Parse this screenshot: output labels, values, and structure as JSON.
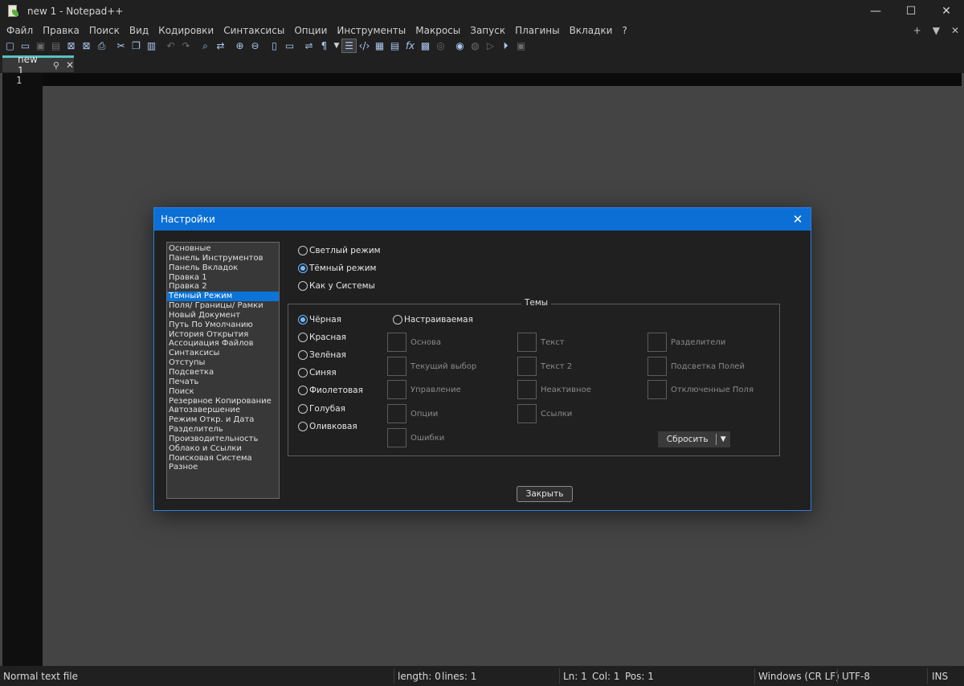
{
  "window": {
    "title": "new 1 - Notepad++",
    "controls": [
      "—",
      "☐",
      "✕"
    ]
  },
  "menu": {
    "items": [
      "Файл",
      "Правка",
      "Поиск",
      "Вид",
      "Кодировки",
      "Синтаксисы",
      "Опции",
      "Инструменты",
      "Макросы",
      "Запуск",
      "Плагины",
      "Вкладки",
      "?"
    ],
    "right": [
      "+",
      "▼",
      "✕"
    ]
  },
  "toolbar": {
    "icons": [
      "new-file-icon",
      "open-file-icon",
      "save-icon",
      "save-all-icon",
      "close-icon",
      "close-all-icon",
      "print-icon",
      "cut-icon",
      "copy-icon",
      "paste-icon",
      "undo-icon",
      "redo-icon",
      "find-icon",
      "replace-icon",
      "zoom-in-icon",
      "zoom-out-icon",
      "sync-vertical-icon",
      "sync-horizontal-icon",
      "word-wrap-icon",
      "show-all-chars-icon",
      "dropdown-icon",
      "indent-guide-icon",
      "lang-xml-icon",
      "doc-map-icon",
      "doc-list-icon",
      "function-list-icon",
      "folder-workspace-icon",
      "monitoring-icon",
      "record-macro-icon",
      "stop-macro-icon",
      "play-macro-icon",
      "play-multiple-icon",
      "save-macro-icon"
    ]
  },
  "tab": {
    "label": "new 1",
    "pin": "📌",
    "close": "✕"
  },
  "editor": {
    "line_number": "1"
  },
  "status": {
    "file_type": "Normal text file",
    "length": "length: 0",
    "lines": "lines: 1",
    "ln": "Ln: 1",
    "col": "Col: 1",
    "pos": "Pos: 1",
    "eol": "Windows (CR LF)",
    "encoding": "UTF-8",
    "mode": "INS"
  },
  "dialog": {
    "title": "Настройки",
    "close": "✕",
    "categories": [
      "Основные",
      "Панель Инструментов",
      "Панель Вкладок",
      "Правка 1",
      "Правка 2",
      "Тёмный Режим",
      "Поля/ Границы/ Рамки",
      "Новый Документ",
      "Путь По Умолчанию",
      "История Открытия",
      "Ассоциация Файлов",
      "Синтаксисы",
      "Отступы",
      "Подсветка",
      "Печать",
      "Поиск",
      "Резервное Копирование",
      "Автозавершение",
      "Режим Откр. и Дата",
      "Разделитель",
      "Производительность",
      "Облако и Ссылки",
      "Поисковая Система",
      "Разное"
    ],
    "selected_category": "Тёмный Режим",
    "modes": {
      "light": "Светлый режим",
      "dark": "Тёмный режим",
      "system": "Как у Системы",
      "selected": "dark"
    },
    "themes_label": "Темы",
    "themes": {
      "black": "Чёрная",
      "red": "Красная",
      "green": "Зелёная",
      "blue": "Синяя",
      "purple": "Фиолетовая",
      "cyan": "Голубая",
      "olive": "Оливковая",
      "custom": "Настраиваемая",
      "selected": "black"
    },
    "colors": {
      "base": "Основа",
      "current_selection": "Текущий выбор",
      "control": "Управление",
      "options": "Опции",
      "errors": "Ошибки",
      "text": "Текст",
      "text2": "Текст 2",
      "inactive": "Неактивное",
      "links": "Ссылки",
      "separators": "Разделители",
      "field_highlight": "Подсветка Полей",
      "disabled_fields": "Отключенные Поля"
    },
    "reset_label": "Сбросить",
    "close_button": "Закрыть"
  }
}
